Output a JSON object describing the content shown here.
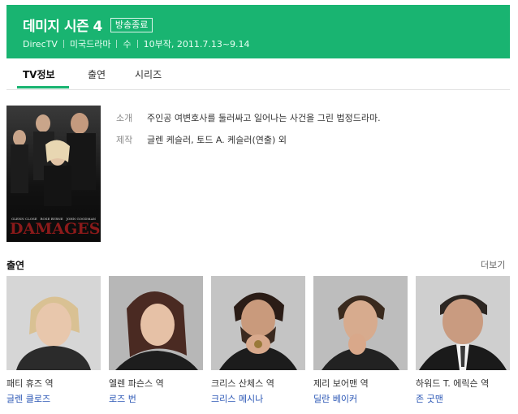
{
  "header": {
    "title": "데미지 시즌 4",
    "badge": "방송종료",
    "meta": [
      "DirecTV",
      "미국드라마",
      "수",
      "10부작, 2011.7.13~9.14"
    ]
  },
  "tabs": [
    "TV정보",
    "출연",
    "시리즈"
  ],
  "poster": {
    "logo_text": "DAMAGES",
    "credit_names": [
      "GLENN CLOSE",
      "ROSE BYRNE",
      "JOHN GOODMAN"
    ]
  },
  "info": {
    "synopsis_label": "소개",
    "synopsis_value": "주인공 여변호사를 둘러싸고 일어나는 사건을 그린 법정드라마.",
    "producer_label": "제작",
    "producer_value": "글렌 케슬러, 토드 A. 케슬러(연출) 외"
  },
  "cast_section": {
    "heading": "출연",
    "more": "더보기",
    "items": [
      {
        "role": "패티 휴즈 역",
        "name": "글렌 클로즈"
      },
      {
        "role": "엘렌 파슨스 역",
        "name": "로즈 번"
      },
      {
        "role": "크리스 산체스 역",
        "name": "크리스 메시나"
      },
      {
        "role": "제리 보어맨 역",
        "name": "딜란 베이커"
      },
      {
        "role": "하워드 T. 에릭슨 역",
        "name": "존 굿맨"
      }
    ]
  },
  "colors": {
    "accent": "#19b471",
    "link": "#2a56b5"
  }
}
